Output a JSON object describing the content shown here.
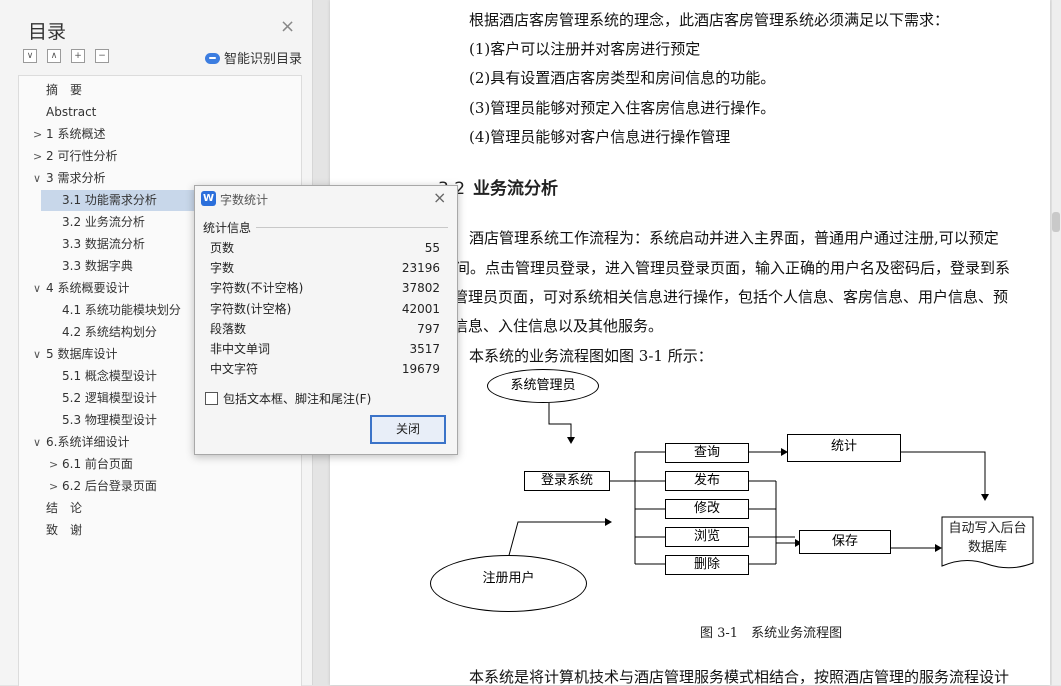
{
  "sidebar": {
    "title": "目录",
    "smart_toc_label": "智能识别目录",
    "toc": [
      {
        "label": "摘　要",
        "arrow": ""
      },
      {
        "label": "Abstract",
        "arrow": ""
      },
      {
        "label": "1  系统概述",
        "arrow": ">"
      },
      {
        "label": "2  可行性分析",
        "arrow": ">"
      },
      {
        "label": "3  需求分析",
        "arrow": "∨"
      },
      {
        "label": "3.1  功能需求分析",
        "arrow": ""
      },
      {
        "label": "3.2  业务流分析",
        "arrow": ""
      },
      {
        "label": "3.3  数据流分析",
        "arrow": ""
      },
      {
        "label": "3.3  数据字典",
        "arrow": ""
      },
      {
        "label": "4  系统概要设计",
        "arrow": "∨"
      },
      {
        "label": "4.1  系统功能模块划分",
        "arrow": ""
      },
      {
        "label": "4.2  系统结构划分",
        "arrow": ""
      },
      {
        "label": "5  数据库设计",
        "arrow": "∨"
      },
      {
        "label": "5.1  概念模型设计",
        "arrow": ""
      },
      {
        "label": "5.2  逻辑模型设计",
        "arrow": ""
      },
      {
        "label": "5.3  物理模型设计",
        "arrow": ""
      },
      {
        "label": "6.系统详细设计",
        "arrow": "∨"
      },
      {
        "label": "6.1  前台页面",
        "arrow": ">"
      },
      {
        "label": "6.2  后台登录页面",
        "arrow": ">"
      },
      {
        "label": "结　论",
        "arrow": ""
      },
      {
        "label": "致　谢",
        "arrow": ""
      }
    ]
  },
  "document": {
    "lines": [
      "根据酒店客房管理系统的理念，此酒店客房管理系统必须满足以下需求：",
      "(1)客户可以注册并对客房进行预定",
      "(2)具有设置酒店客房类型和房间信息的功能。",
      "(3)管理员能够对预定入住客房信息进行操作。",
      "(4)管理员能够对客户信息进行操作管理"
    ],
    "heading_num": "3.2",
    "heading_text": "业务流分析",
    "paragraph": [
      "酒店管理系统工作流程为：系统启动并进入主界面，普通用户通过注册,可以预定",
      "间。点击管理员登录，进入管理员登录页面，输入正确的用户名及密码后，登录到系",
      "管理员页面，可对系统相关信息进行操作，包括个人信息、客房信息、用户信息、预",
      "信息、入住信息以及其他服务。"
    ],
    "figure_intro": "本系统的业务流程图如图 3-1 所示：",
    "figure_caption": "图 3-1　系统业务流程图",
    "bottom_line": "本系统是将计算机技术与酒店管理服务模式相结合，按照酒店管理的服务流程设计"
  },
  "flowchart": {
    "admin": "系统管理员",
    "login": "登录系统",
    "query": "查询",
    "publish": "发布",
    "modify": "修改",
    "browse": "浏览",
    "delete": "删除",
    "stats": "统计",
    "save": "保存",
    "database_line1": "自动写入后台",
    "database_line2": "数据库",
    "user": "注册用户"
  },
  "word_count_dialog": {
    "title": "字数统计",
    "section": "统计信息",
    "stats": [
      {
        "label": "页数",
        "value": "55"
      },
      {
        "label": "字数",
        "value": "23196"
      },
      {
        "label": "字符数(不计空格)",
        "value": "37802"
      },
      {
        "label": "字符数(计空格)",
        "value": "42001"
      },
      {
        "label": "段落数",
        "value": "797"
      },
      {
        "label": "非中文单词",
        "value": "3517"
      },
      {
        "label": "中文字符",
        "value": "19679"
      }
    ],
    "checkbox_label": "包括文本框、脚注和尾注(F)",
    "checkbox_checked": false,
    "close_button": "关闭"
  },
  "colors": {
    "toc_active": "#c8d7ea",
    "dialog_button_border": "#3b73c8",
    "app_icon": "#2b6fdb"
  }
}
